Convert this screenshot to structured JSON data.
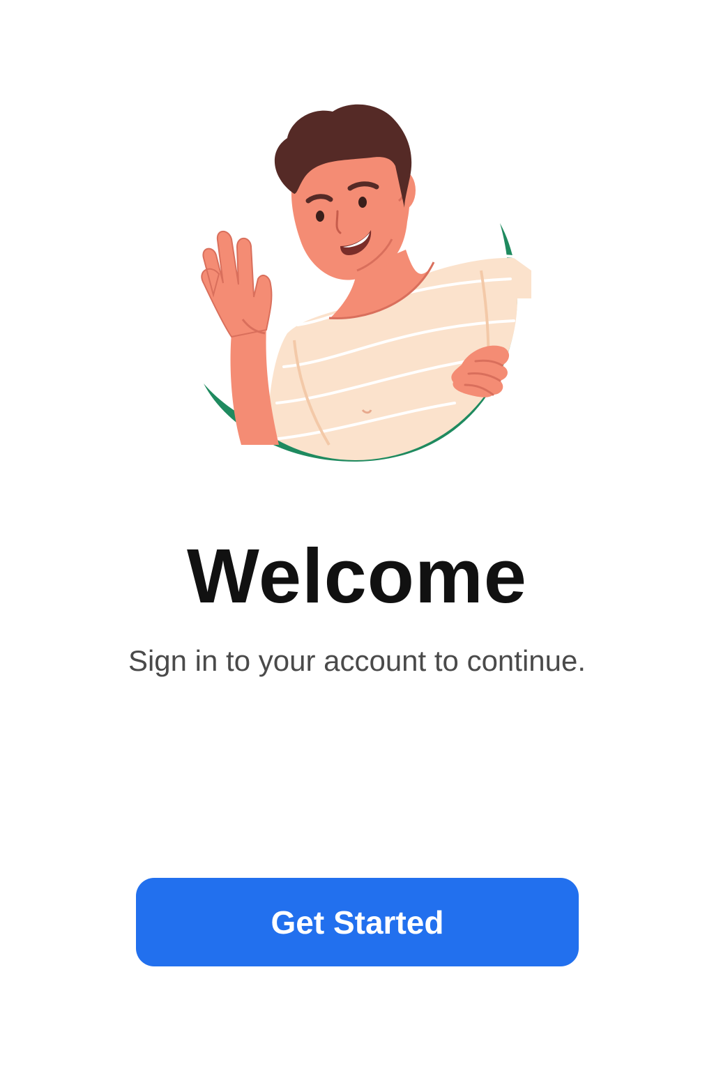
{
  "welcome": {
    "title": "Welcome",
    "subtitle": "Sign in to your account to continue.",
    "illustration": "waving-person-illustration"
  },
  "actions": {
    "get_started_label": "Get Started"
  },
  "colors": {
    "background": "#ffffff",
    "title": "#111111",
    "subtitle": "#4a4a4a",
    "button_bg": "#2270ee",
    "button_text": "#ffffff",
    "accent_green": "#1f8a5f",
    "skin": "#f48c74",
    "hair": "#552a26",
    "shirt": "#fbe2cc"
  }
}
